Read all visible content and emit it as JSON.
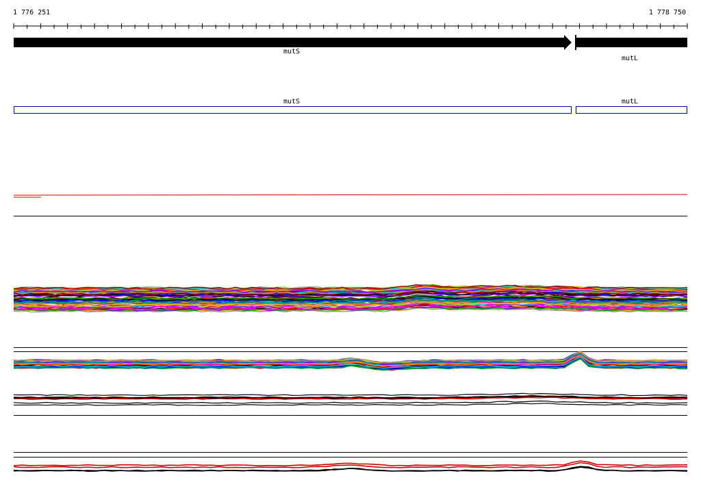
{
  "ruler": {
    "start_label": "1 776 251",
    "end_label": "1 778 750"
  },
  "genes": [
    {
      "name": "mutS",
      "strand": "+"
    },
    {
      "name": "mutL",
      "strand": "+"
    }
  ],
  "features": [
    {
      "name": "mutS"
    },
    {
      "name": "mutL"
    }
  ],
  "colors": {
    "gene_fill": "#000000",
    "feature_outline": "#0000aa",
    "accent_line": "#cc0000",
    "separator": "#000000"
  },
  "track_palette": [
    "#ff0000",
    "#00aa00",
    "#0000ff",
    "#ff00ff",
    "#00cccc",
    "#cccc00",
    "#ff8800",
    "#8800ff",
    "#008888",
    "#880000",
    "#000000",
    "#999999"
  ]
}
